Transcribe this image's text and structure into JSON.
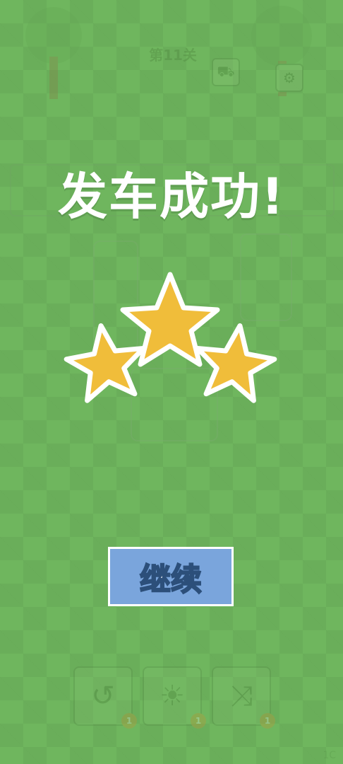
{
  "game": {
    "level_title": "第11关",
    "settings_icon": "gear-icon",
    "hint_icon": "car-icon",
    "tools": [
      {
        "name": "undo",
        "icon": "undo-icon",
        "count": "1"
      },
      {
        "name": "hint",
        "icon": "lightbulb-icon",
        "count": "1"
      },
      {
        "name": "shuffle",
        "icon": "shuffle-icon",
        "count": "1"
      }
    ]
  },
  "result": {
    "title": "发车成功!",
    "stars_earned": 3,
    "stars_total": 3,
    "continue_label": "继续"
  },
  "colors": {
    "grass": "#6cb35b",
    "star_fill": "#f0bd3a",
    "star_outline": "#ffffff",
    "button": "#7aa5dc"
  },
  "corner_text": "1C"
}
